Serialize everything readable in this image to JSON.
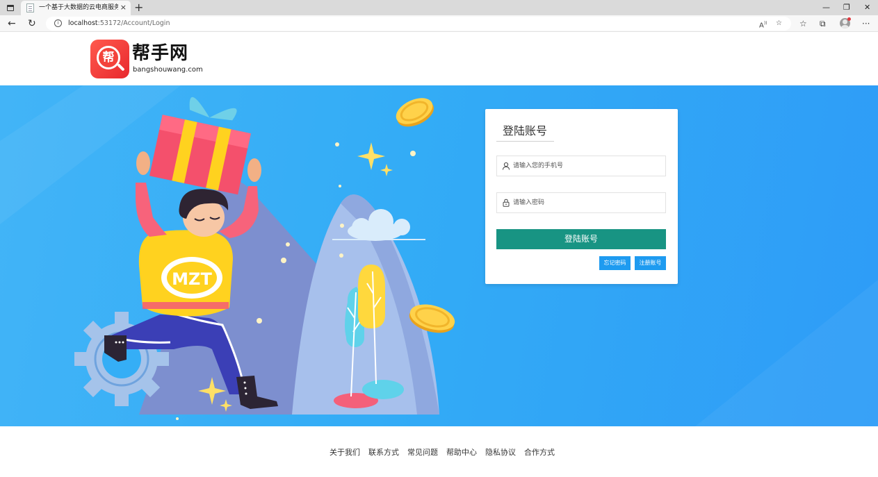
{
  "browser": {
    "tab_title": "一个基于大数据的云电商服务平台",
    "tab_close": "×",
    "new_tab": "+",
    "url_host": "localhost",
    "url_rest": ":53172/Account/Login",
    "window_controls": {
      "minimize": "—",
      "restore": "❐",
      "close": "✕"
    }
  },
  "header": {
    "logo_char": "帮",
    "logo_title": "帮手网",
    "logo_domain": "bangshouwang.com"
  },
  "illustration": {
    "shirt_text": "MZT"
  },
  "login": {
    "title": "登陆账号",
    "phone_placeholder": "请输入您的手机号",
    "password_placeholder": "请输入密码",
    "submit_label": "登陆账号",
    "forgot_label": "忘记密码",
    "register_label": "注册账号"
  },
  "footer": {
    "links": [
      "关于我们",
      "联系方式",
      "常见问题",
      "帮助中心",
      "隐私协议",
      "合作方式"
    ]
  },
  "colors": {
    "banner_blue": "#35aef6",
    "primary_green": "#189483",
    "secondary_blue": "#1e9bf0",
    "logo_red": "#f3433b"
  }
}
